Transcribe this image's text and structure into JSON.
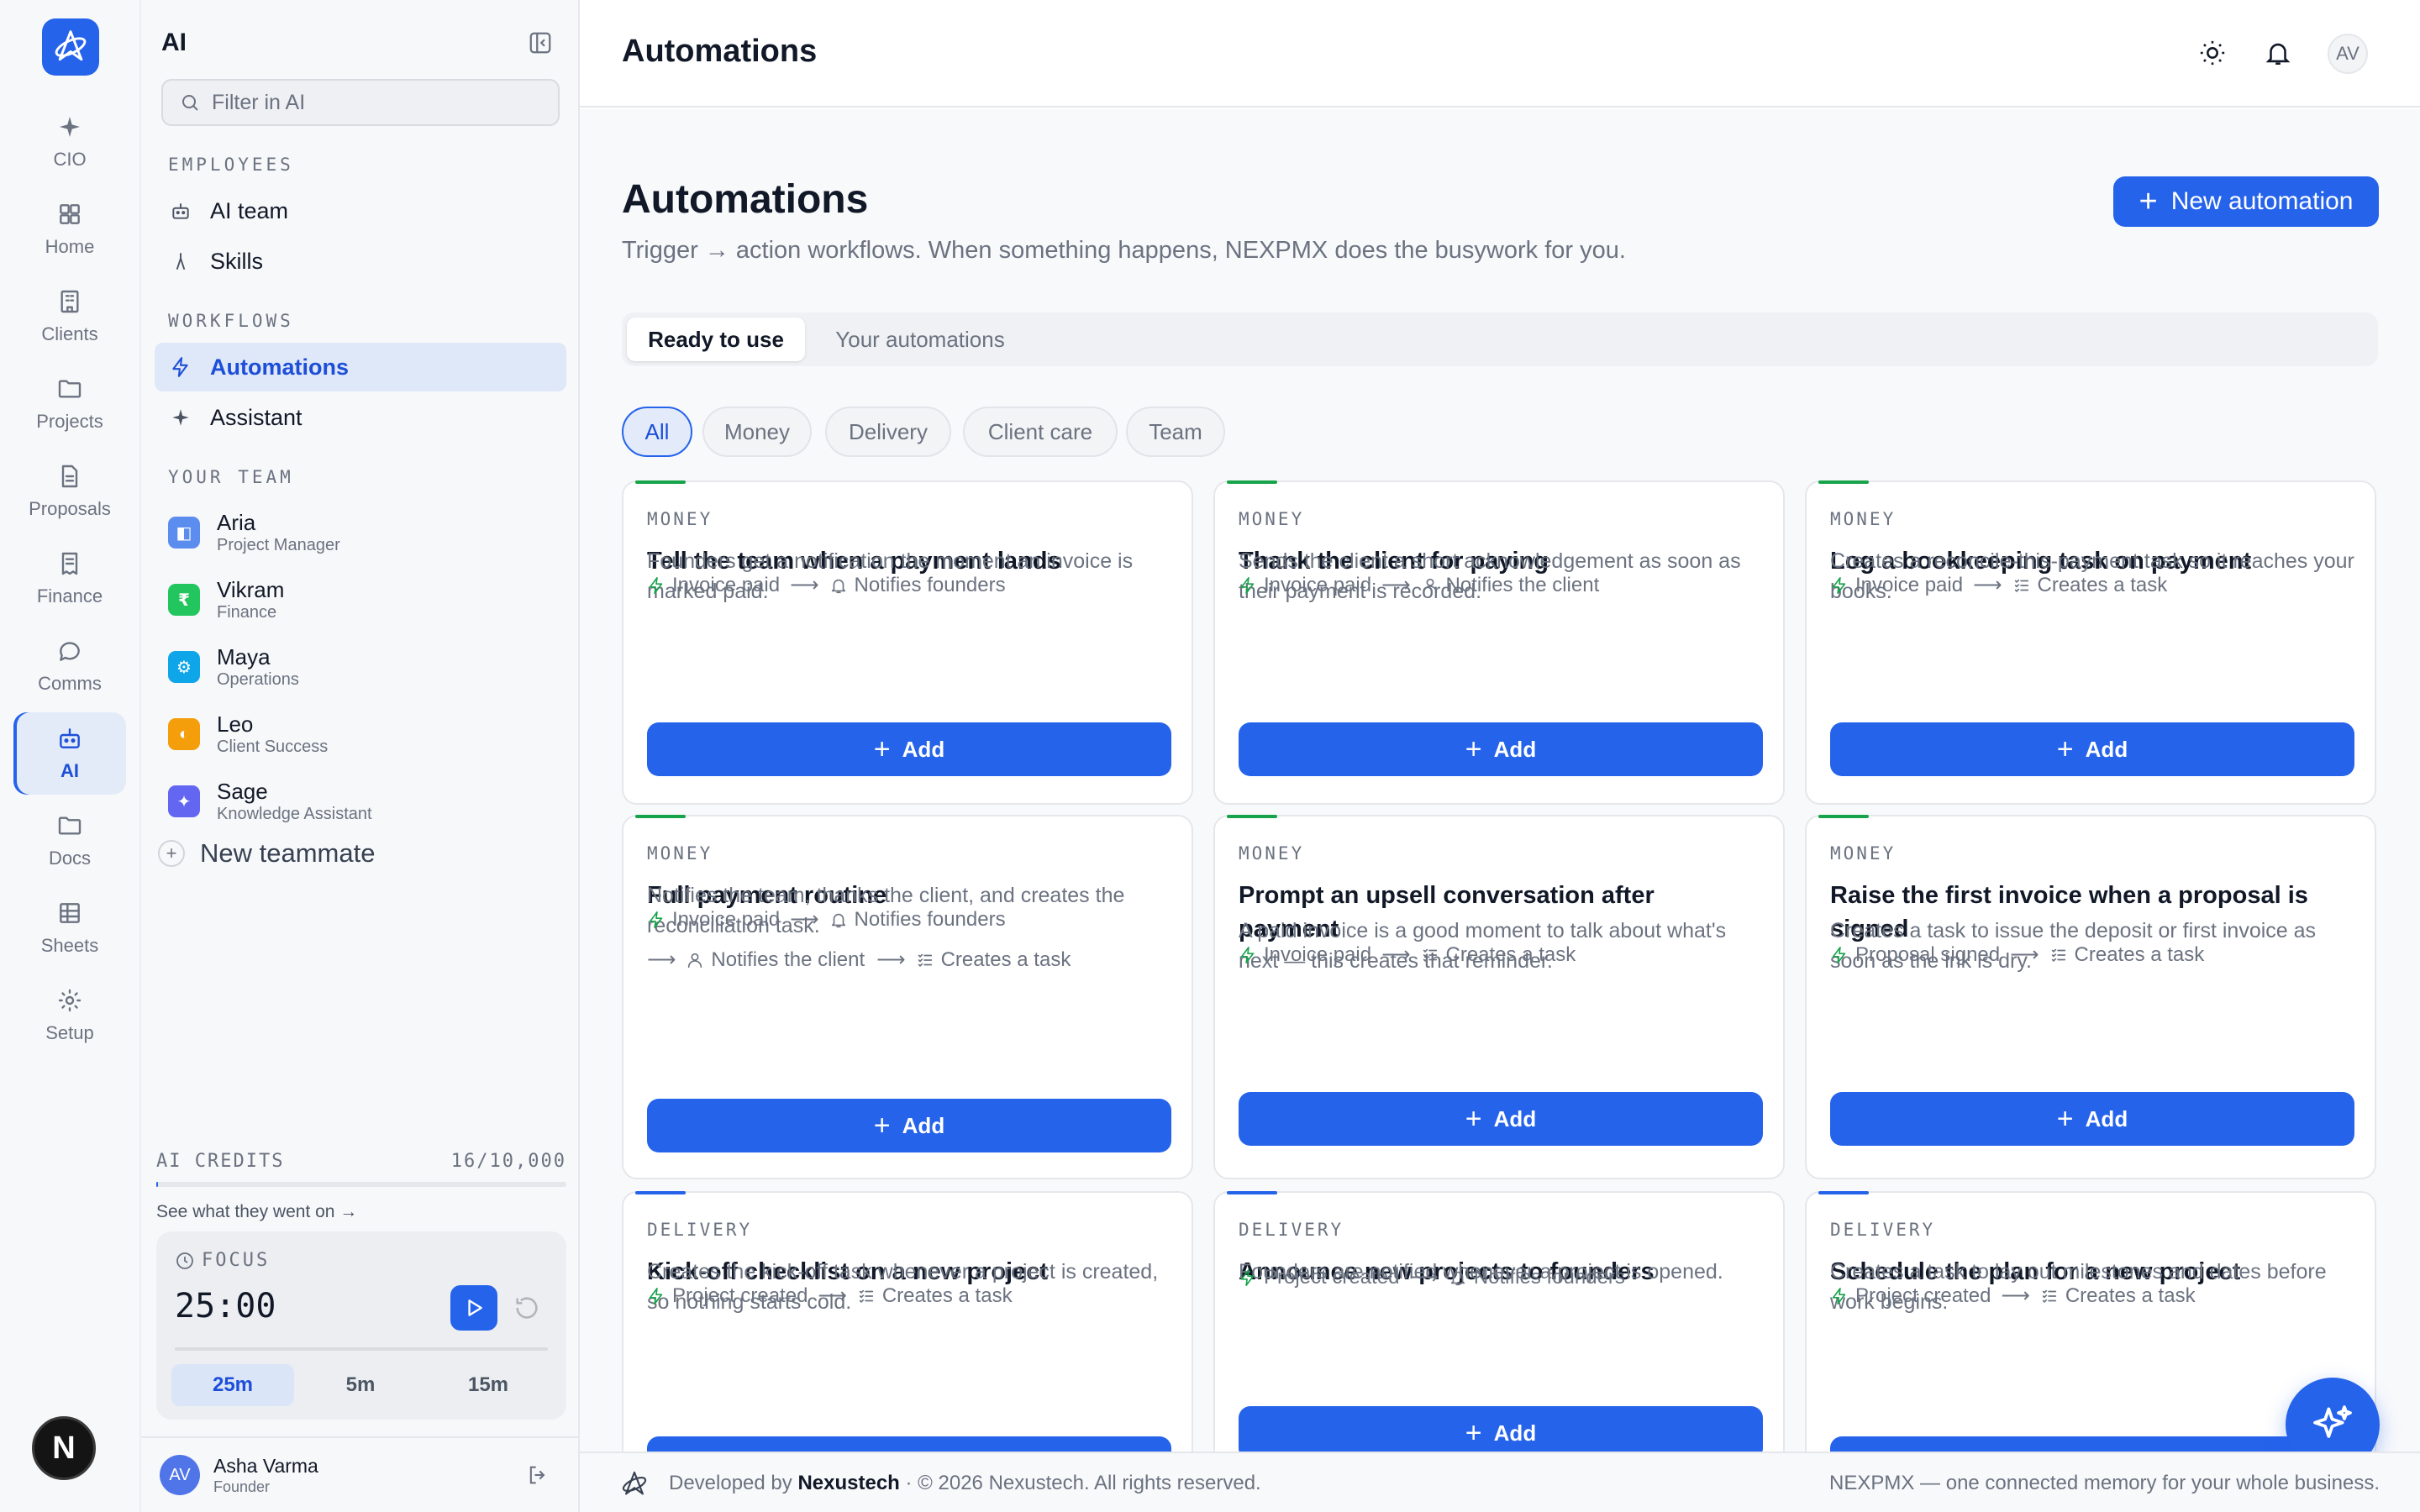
{
  "colors": {
    "accent": "#2563eb",
    "money": "#16a34a",
    "delivery": "#2563eb"
  },
  "rail": {
    "items": [
      {
        "label": "CIO",
        "icon": "sparkle-icon"
      },
      {
        "label": "Home",
        "icon": "grid-icon"
      },
      {
        "label": "Clients",
        "icon": "building-icon"
      },
      {
        "label": "Projects",
        "icon": "folder-icon"
      },
      {
        "label": "Proposals",
        "icon": "document-icon"
      },
      {
        "label": "Finance",
        "icon": "receipt-icon"
      },
      {
        "label": "Comms",
        "icon": "chat-icon"
      },
      {
        "label": "AI",
        "icon": "robot-icon",
        "active": true
      },
      {
        "label": "Docs",
        "icon": "folder-icon"
      },
      {
        "label": "Sheets",
        "icon": "table-icon"
      },
      {
        "label": "Setup",
        "icon": "gear-icon"
      }
    ],
    "badge": "N"
  },
  "sidebar": {
    "title": "AI",
    "search_placeholder": "Filter in AI",
    "sections": {
      "employees": "EMPLOYEES",
      "workflows": "WORKFLOWS",
      "team": "YOUR TEAM"
    },
    "employees": [
      {
        "label": "AI team",
        "icon": "robot-icon"
      },
      {
        "label": "Skills",
        "icon": "skill-icon"
      }
    ],
    "workflows": [
      {
        "label": "Automations",
        "icon": "bolt-icon",
        "active": true
      },
      {
        "label": "Assistant",
        "icon": "sparkle-icon"
      }
    ],
    "team": [
      {
        "name": "Aria",
        "role": "Project Manager",
        "color": "#5b8def",
        "glyph": "◧"
      },
      {
        "name": "Vikram",
        "role": "Finance",
        "color": "#22c55e",
        "glyph": "₹"
      },
      {
        "name": "Maya",
        "role": "Operations",
        "color": "#0ea5e9",
        "glyph": "⚙"
      },
      {
        "name": "Leo",
        "role": "Client Success",
        "color": "#f59e0b",
        "glyph": "◐"
      },
      {
        "name": "Sage",
        "role": "Knowledge Assistant",
        "color": "#6366f1",
        "glyph": "✦"
      }
    ],
    "new_teammate": "New teammate",
    "credits": {
      "label": "AI CREDITS",
      "value": "16/10,000",
      "used_fraction": 0.0016,
      "link": "See what they went on →"
    },
    "focus": {
      "label": "FOCUS",
      "time": "25:00",
      "presets": [
        "25m",
        "5m",
        "15m"
      ],
      "active_preset": "25m"
    },
    "user": {
      "initials": "AV",
      "name": "Asha Varma",
      "role": "Founder"
    }
  },
  "topbar": {
    "title": "Automations",
    "avatar": "AV"
  },
  "main": {
    "title": "Automations",
    "subtitle": "Trigger → action workflows. When something happens, NEXPMX does the busywork for you.",
    "new_button": "New automation",
    "tabs": [
      "Ready to use",
      "Your automations"
    ],
    "active_tab": "Ready to use",
    "filters": [
      "All",
      "Money",
      "Delivery",
      "Client care",
      "Team"
    ],
    "active_filter": "All",
    "add_label": "Add",
    "cards": [
      {
        "category": "MONEY",
        "title": "Tell the team when a payment lands",
        "description": "Founders get a notification the moment an invoice is marked paid.",
        "trigger": "Invoice paid",
        "actions": [
          {
            "icon": "bell-icon",
            "label": "Notifies founders"
          }
        ]
      },
      {
        "category": "MONEY",
        "title": "Thank the client for paying",
        "description": "Sends the client a short acknowledgement as soon as their payment is recorded.",
        "trigger": "Invoice paid",
        "actions": [
          {
            "icon": "user-icon",
            "label": "Notifies the client"
          }
        ]
      },
      {
        "category": "MONEY",
        "title": "Log a bookkeeping task on payment",
        "description": "Creates a reconcile-this-payment task so it reaches your books.",
        "trigger": "Invoice paid",
        "actions": [
          {
            "icon": "checklist-icon",
            "label": "Creates a task"
          }
        ]
      },
      {
        "category": "MONEY",
        "title": "Full payment routine",
        "description": "Notifies the team, thanks the client, and creates the reconciliation task.",
        "trigger": "Invoice paid",
        "actions": [
          {
            "icon": "bell-icon",
            "label": "Notifies founders"
          },
          {
            "icon": "user-icon",
            "label": "Notifies the client"
          },
          {
            "icon": "checklist-icon",
            "label": "Creates a task"
          }
        ]
      },
      {
        "category": "MONEY",
        "title": "Prompt an upsell conversation after payment",
        "description": "A paid invoice is a good moment to talk about what's next — this creates that reminder.",
        "trigger": "Invoice paid",
        "actions": [
          {
            "icon": "checklist-icon",
            "label": "Creates a task"
          }
        ]
      },
      {
        "category": "MONEY",
        "title": "Raise the first invoice when a proposal is signed",
        "description": "Creates a task to issue the deposit or first invoice as soon as the ink is dry.",
        "trigger": "Proposal signed",
        "actions": [
          {
            "icon": "checklist-icon",
            "label": "Creates a task"
          }
        ]
      },
      {
        "category": "DELIVERY",
        "title": "Kick-off checklist on a new project",
        "description": "Creates the kick-off task whenever a project is created, so nothing starts cold.",
        "trigger": "Project created",
        "actions": [
          {
            "icon": "checklist-icon",
            "label": "Creates a task"
          }
        ]
      },
      {
        "category": "DELIVERY",
        "title": "Announce new projects to founders",
        "description": "Founders are notified whenever a project is opened.",
        "trigger": "Project created",
        "actions": [
          {
            "icon": "bell-icon",
            "label": "Notifies founders"
          }
        ]
      },
      {
        "category": "DELIVERY",
        "title": "Schedule the plan for a new project",
        "description": "Creates a task to lay out milestones and dates before work begins.",
        "trigger": "Project created",
        "actions": [
          {
            "icon": "checklist-icon",
            "label": "Creates a task"
          }
        ]
      }
    ]
  },
  "footer": {
    "prefix": "Developed by",
    "brand": "Nexustech",
    "suffix": "· © 2026 Nexustech. All rights reserved.",
    "right": "NEXPMX — one connected memory for your whole business."
  }
}
